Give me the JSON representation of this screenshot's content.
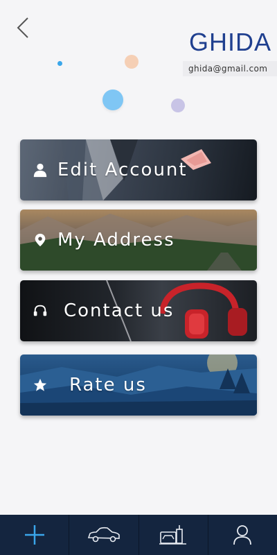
{
  "header": {
    "back_icon": "chevron-left-icon",
    "name": "GHIDA",
    "email": "ghida@gmail.com"
  },
  "colors": {
    "accent": "#1f3f8f",
    "nav_background": "#14253f",
    "nav_active": "#3aa6ea"
  },
  "menu": [
    {
      "label": "Edit Account",
      "icon": "user-icon"
    },
    {
      "label": "My Address",
      "icon": "location-pin-icon"
    },
    {
      "label": "Contact us",
      "icon": "headphones-icon"
    },
    {
      "label": "Rate us",
      "icon": "star-icon"
    }
  ],
  "bottom_nav": [
    {
      "icon": "plus-icon",
      "active": true
    },
    {
      "icon": "car-icon",
      "active": false
    },
    {
      "icon": "car-wash-icon",
      "active": false
    },
    {
      "icon": "profile-icon",
      "active": false
    }
  ]
}
